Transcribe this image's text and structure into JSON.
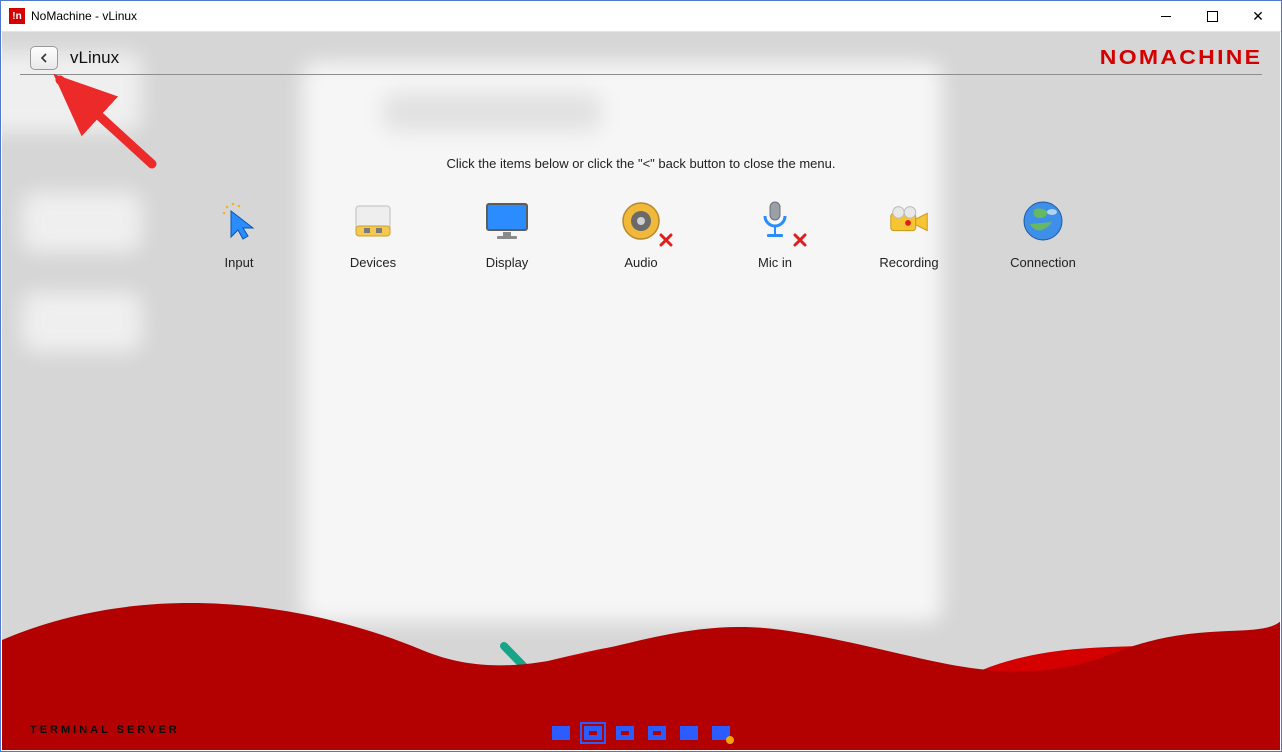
{
  "window": {
    "title": "NoMachine - vLinux",
    "app_icon_label": "!n"
  },
  "header": {
    "session_name": "vLinux",
    "brand": "NOMACHINE"
  },
  "instruction": "Click the items below or click the \"<\" back button to close the menu.",
  "menu": [
    {
      "id": "input",
      "label": "Input",
      "icon": "cursor-icon",
      "error": false
    },
    {
      "id": "devices",
      "label": "Devices",
      "icon": "usb-disk-icon",
      "error": false
    },
    {
      "id": "display",
      "label": "Display",
      "icon": "monitor-icon",
      "error": false
    },
    {
      "id": "audio",
      "label": "Audio",
      "icon": "speaker-icon",
      "error": true
    },
    {
      "id": "mic",
      "label": "Mic in",
      "icon": "microphone-icon",
      "error": true
    },
    {
      "id": "recording",
      "label": "Recording",
      "icon": "camcorder-icon",
      "error": false
    },
    {
      "id": "connection",
      "label": "Connection",
      "icon": "globe-icon",
      "error": false
    }
  ],
  "footer": {
    "label": "TERMINAL SERVER"
  },
  "tray": [
    {
      "id": "tray-1",
      "selected": false,
      "gear": false
    },
    {
      "id": "tray-2",
      "selected": true,
      "gear": false
    },
    {
      "id": "tray-3",
      "selected": false,
      "gear": false
    },
    {
      "id": "tray-4",
      "selected": false,
      "gear": false
    },
    {
      "id": "tray-5",
      "selected": false,
      "gear": false
    },
    {
      "id": "tray-6",
      "selected": false,
      "gear": true
    }
  ]
}
